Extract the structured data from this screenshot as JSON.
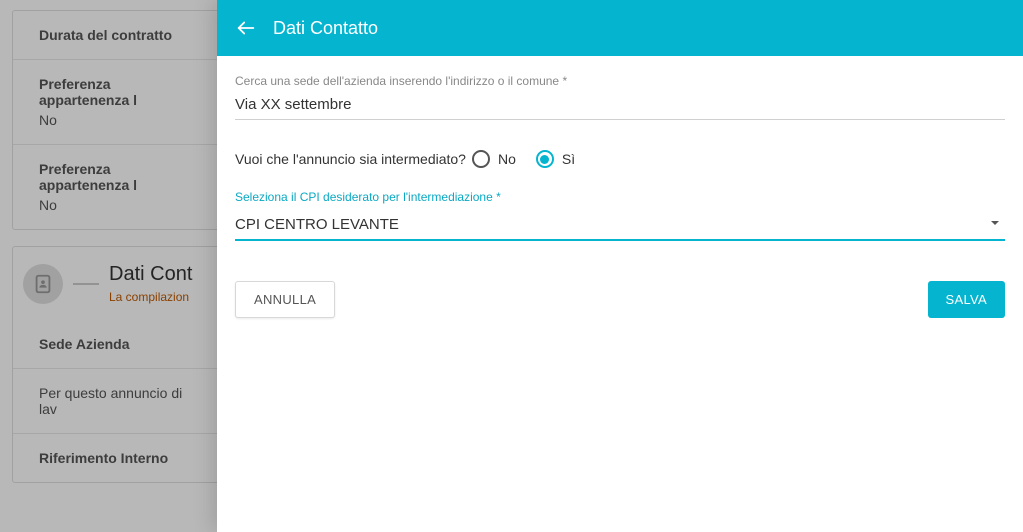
{
  "background": {
    "row1": {
      "label": "Durata del contratto"
    },
    "row2": {
      "label": "Preferenza appartenenza l",
      "value": "No"
    },
    "row3": {
      "label": "Preferenza appartenenza l",
      "value": "No"
    },
    "section": {
      "title": "Dati Cont",
      "subtitle": "La compilazion"
    },
    "row4": {
      "label": "Sede Azienda"
    },
    "row5": {
      "label": "Per questo annuncio di lav"
    },
    "row6": {
      "label": "Riferimento Interno"
    }
  },
  "modal": {
    "title": "Dati Contatto",
    "searchLabel": "Cerca una sede dell'azienda inserendo l'indirizzo o il comune",
    "searchValue": "Via XX settembre",
    "radioQuestion": "Vuoi che l'annuncio sia intermediato?",
    "radioNo": "No",
    "radioSi": "Sì",
    "radioSelected": "si",
    "cpiLabel": "Seleziona il CPI desiderato per l'intermediazione",
    "cpiValue": "CPI CENTRO LEVANTE",
    "cancelLabel": "ANNULLA",
    "saveLabel": "SALVA"
  }
}
